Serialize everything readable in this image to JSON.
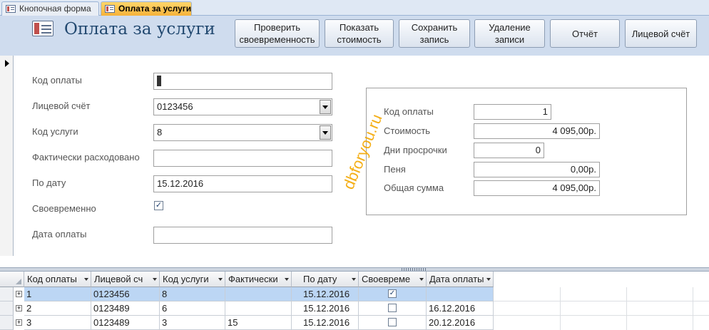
{
  "tabs": [
    {
      "label": "Кнопочная форма",
      "active": false
    },
    {
      "label": "Оплата за услуги",
      "active": true
    }
  ],
  "header": {
    "title": "Оплата за услуги",
    "buttons": [
      {
        "label": "Проверить\nсвоевременность"
      },
      {
        "label": "Показать\nстоимость"
      },
      {
        "label": "Сохранить\nзапись"
      },
      {
        "label": "Удаление\nзаписи"
      },
      {
        "label": "Отчёт"
      },
      {
        "label": "Лицевой счёт"
      }
    ]
  },
  "form": {
    "fields": [
      {
        "label": "Код оплаты",
        "value": "1",
        "type": "text"
      },
      {
        "label": "Лицевой счёт",
        "value": "0123456",
        "type": "combo"
      },
      {
        "label": "Код услуги",
        "value": "8",
        "type": "combo"
      },
      {
        "label": "Фактически расходовано",
        "value": "",
        "type": "text"
      },
      {
        "label": "По дату",
        "value": "15.12.2016",
        "type": "text"
      },
      {
        "label": "Своевременно",
        "checked": true,
        "type": "check"
      },
      {
        "label": "Дата оплаты",
        "value": "",
        "type": "text"
      }
    ]
  },
  "calc": {
    "rows": [
      {
        "label": "Код оплаты",
        "value": "1"
      },
      {
        "label": "Стоимость",
        "value": "4 095,00р."
      },
      {
        "label": "Дни просрочки",
        "value": "0"
      },
      {
        "label": "Пеня",
        "value": "0,00р."
      },
      {
        "label": "Общая сумма",
        "value": "4 095,00р."
      }
    ]
  },
  "watermark": "dbforyou.ru",
  "datasheet": {
    "columns": [
      "Код оплаты",
      "Лицевой сч",
      "Код услуги",
      "Фактически",
      "По дату",
      "Своевреме",
      "Дата оплаты"
    ],
    "rows": [
      {
        "cells": [
          "1",
          "0123456",
          "8",
          "",
          "15.12.2016",
          "",
          ""
        ],
        "checked": true,
        "selected": true
      },
      {
        "cells": [
          "2",
          "0123489",
          "6",
          "",
          "15.12.2016",
          "",
          "16.12.2016"
        ],
        "checked": false,
        "selected": false
      },
      {
        "cells": [
          "3",
          "0123489",
          "3",
          "15",
          "15.12.2016",
          "",
          "20.12.2016"
        ],
        "checked": false,
        "selected": false
      }
    ]
  },
  "colors": {
    "header_bg": "#cfdcee",
    "title": "#21486f",
    "active_tab": "#f6b23a",
    "selected_row": "#bcd6f4",
    "watermark": "#f3a700"
  }
}
